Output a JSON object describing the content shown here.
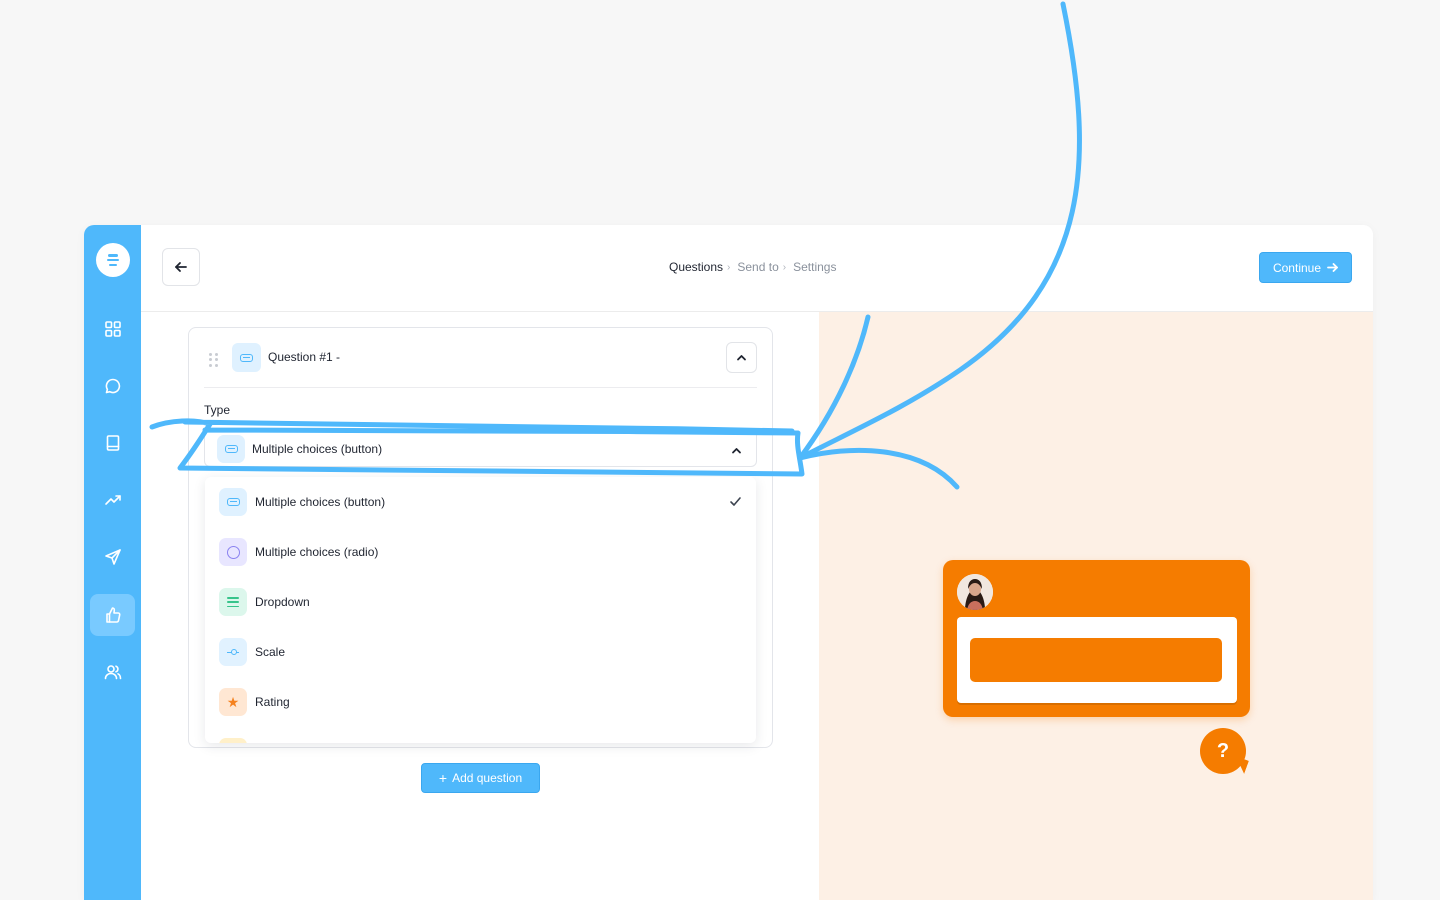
{
  "breadcrumb": {
    "items": [
      {
        "label": "Questions",
        "sep": "›"
      },
      {
        "label": "Send to",
        "sep": "›"
      },
      {
        "label": "Settings",
        "sep": ""
      }
    ]
  },
  "toolbar": {
    "continue_label": "Continue"
  },
  "question": {
    "title": "Question #1 -",
    "type_label": "Type",
    "selected_type": "Multiple choices (button)"
  },
  "type_options": [
    {
      "label": "Multiple choices (button)",
      "icon": "button-icon",
      "selected": true
    },
    {
      "label": "Multiple choices (radio)",
      "icon": "radio-icon",
      "selected": false
    },
    {
      "label": "Dropdown",
      "icon": "list-icon",
      "selected": false
    },
    {
      "label": "Scale",
      "icon": "scale-icon",
      "selected": false
    },
    {
      "label": "Rating",
      "icon": "star-icon",
      "selected": false
    }
  ],
  "actions": {
    "add_question_label": "Add question"
  },
  "preview": {
    "help_symbol": "?"
  },
  "colors": {
    "brand": "#4fb8fb",
    "widget": "#f57c00",
    "preview_bg": "#fdf0e5",
    "annotation": "#4fb8fb"
  },
  "sidebar": {
    "items": [
      {
        "icon": "dashboard-icon",
        "active": false
      },
      {
        "icon": "chat-icon",
        "active": false
      },
      {
        "icon": "book-icon",
        "active": false
      },
      {
        "icon": "trending-icon",
        "active": false
      },
      {
        "icon": "send-icon",
        "active": false
      },
      {
        "icon": "thumbs-up-icon",
        "active": true
      },
      {
        "icon": "users-icon",
        "active": false
      }
    ]
  }
}
